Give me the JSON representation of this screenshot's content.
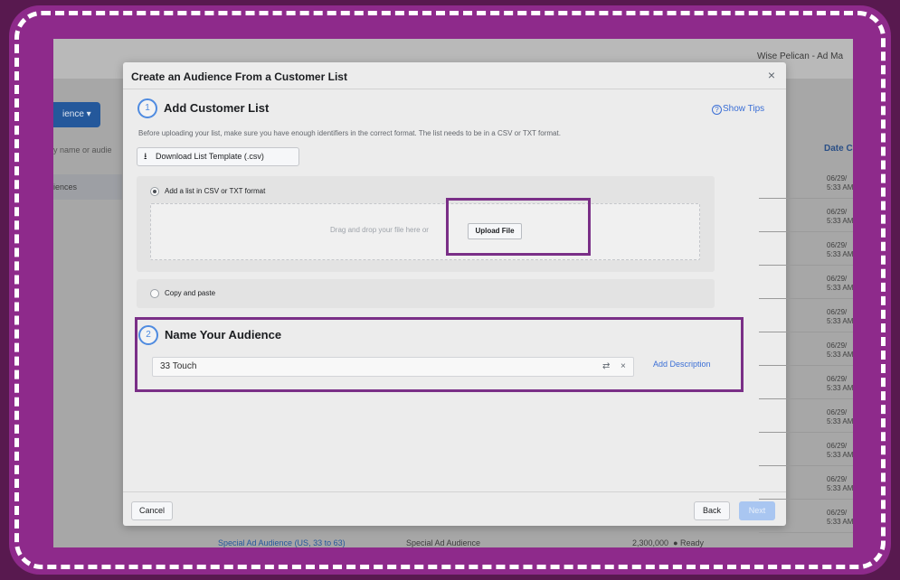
{
  "background_app": {
    "account_name": "Wise Pelican - Ad Ma",
    "create_button": "ience ▾",
    "search_placeholder": "y name or audie",
    "side_item": "iences",
    "date_column_header": "Date C",
    "date_rows": [
      {
        "date": "06/29/",
        "time": "5:33 AM"
      },
      {
        "date": "06/29/",
        "time": "5:33 AM"
      },
      {
        "date": "06/29/",
        "time": "5:33 AM"
      },
      {
        "date": "06/29/",
        "time": "5:33 AM"
      },
      {
        "date": "06/29/",
        "time": "5:33 AM"
      },
      {
        "date": "06/29/",
        "time": "5:33 AM"
      },
      {
        "date": "06/29/",
        "time": "5:33 AM"
      },
      {
        "date": "06/29/",
        "time": "5:33 AM"
      },
      {
        "date": "06/29/",
        "time": "5:33 AM"
      },
      {
        "date": "06/29/",
        "time": "5:33 AM"
      },
      {
        "date": "06/29/",
        "time": "5:33 AM"
      }
    ],
    "bottom_row": {
      "name": "Special Ad Audience (US, 33 to 63)",
      "type": "Special Ad Audience",
      "size": "2,300,000",
      "status": "● Ready"
    }
  },
  "modal": {
    "title": "Create an Audience From a Customer List",
    "close_icon": "×",
    "step1": {
      "number": "1",
      "title": "Add Customer List",
      "show_tips": "Show Tips",
      "tips_icon": "?",
      "description": "Before uploading your list, make sure you have enough identifiers in the correct format. The list needs to be in a CSV or TXT format.",
      "download_icon": "⭳",
      "download_button": "Download List Template (.csv)",
      "option_upload_label": "Add a list in CSV or TXT format",
      "dropzone_hint": "Drag and drop your file here or",
      "upload_button": "Upload File",
      "option_paste_label": "Copy and paste"
    },
    "step2": {
      "number": "2",
      "title": "Name Your Audience",
      "audience_name": "33 Touch",
      "counter_icon": "⇄",
      "clear_icon": "×",
      "add_description": "Add Description"
    },
    "footer": {
      "cancel": "Cancel",
      "back": "Back",
      "next": "Next"
    }
  },
  "colors": {
    "frame": "#8e2a8b",
    "highlight": "#7a2f87",
    "link": "#3b6fd6",
    "primary_disabled": "#a9c6f1"
  }
}
